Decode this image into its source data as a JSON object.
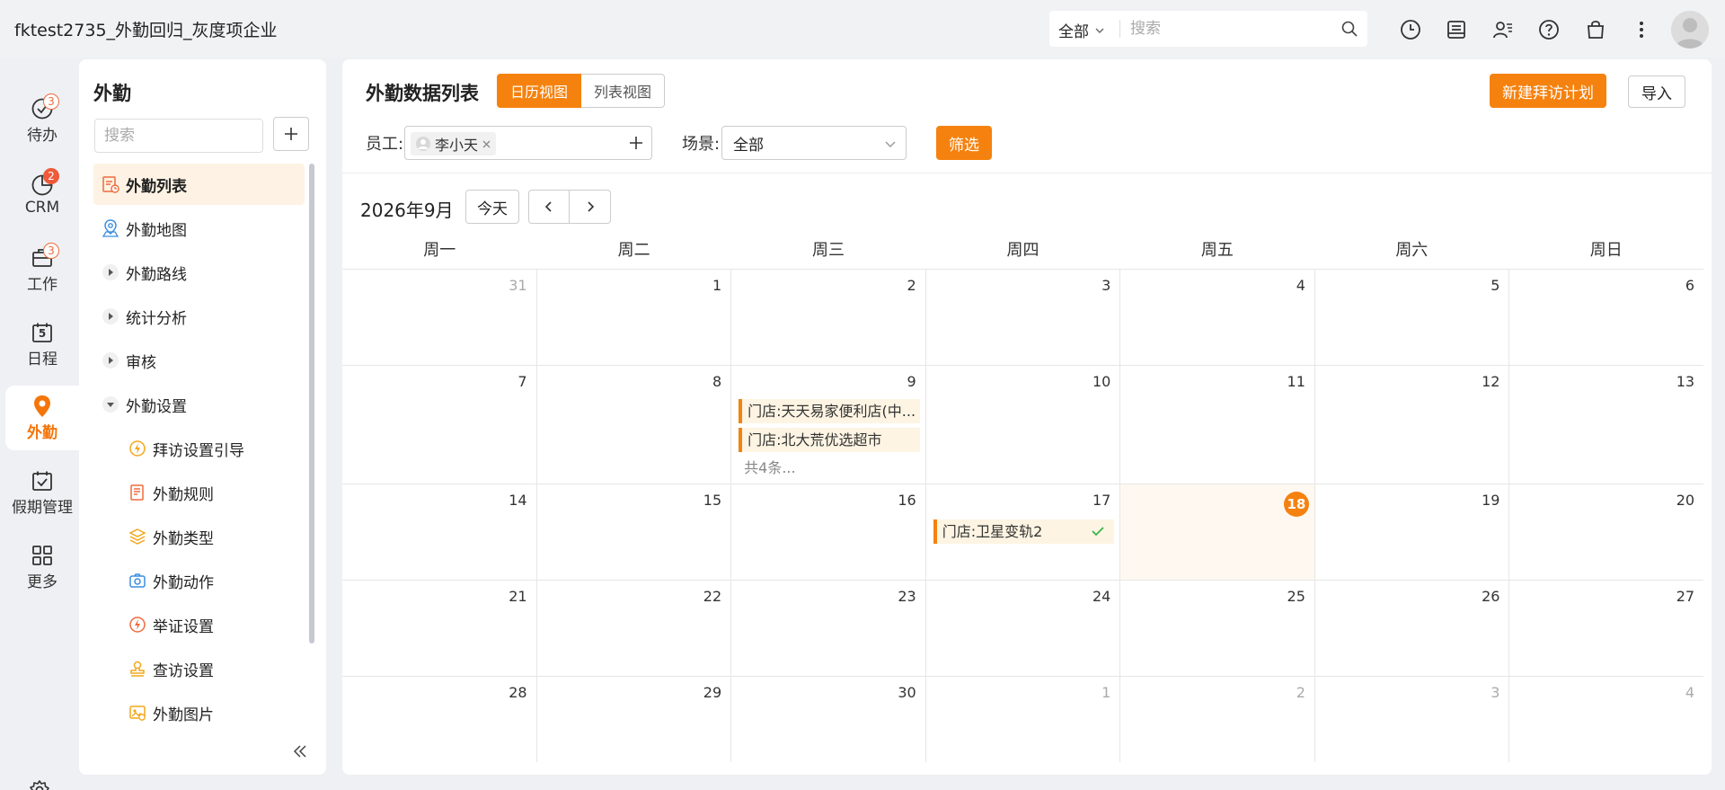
{
  "app": {
    "title": "fktest2735_外勤回归_灰度项企业"
  },
  "search": {
    "scope": "全部",
    "placeholder": "搜索"
  },
  "rail": {
    "items": [
      {
        "label": "待办",
        "badge": "3"
      },
      {
        "label": "CRM",
        "badge": "2"
      },
      {
        "label": "工作",
        "badge": "3"
      },
      {
        "label": "日程",
        "icon_text": "5"
      },
      {
        "label": "外勤"
      },
      {
        "label": "假期管理"
      },
      {
        "label": "更多"
      }
    ]
  },
  "sidebar": {
    "title": "外勤",
    "search_placeholder": "搜索",
    "items": [
      {
        "label": "外勤列表"
      },
      {
        "label": "外勤地图"
      },
      {
        "label": "外勤路线"
      },
      {
        "label": "统计分析"
      },
      {
        "label": "审核"
      },
      {
        "label": "外勤设置"
      },
      {
        "label": "拜访设置引导"
      },
      {
        "label": "外勤规则"
      },
      {
        "label": "外勤类型"
      },
      {
        "label": "外勤动作"
      },
      {
        "label": "举证设置"
      },
      {
        "label": "查访设置"
      },
      {
        "label": "外勤图片"
      }
    ]
  },
  "main": {
    "title": "外勤数据列表",
    "view_calendar": "日历视图",
    "view_list": "列表视图",
    "new_plan": "新建拜访计划",
    "import": "导入",
    "employee_label": "员工:",
    "employee_tag": "李小天",
    "scene_label": "场景:",
    "scene_value": "全部",
    "filter_button": "筛选"
  },
  "calendar": {
    "month_label": "2026年9月",
    "today_button": "今天",
    "weekdays": [
      "周一",
      "周二",
      "周三",
      "周四",
      "周五",
      "周六",
      "周日"
    ],
    "weeks": [
      [
        "31",
        "1",
        "2",
        "3",
        "4",
        "5",
        "6"
      ],
      [
        "7",
        "8",
        "9",
        "10",
        "11",
        "12",
        "13"
      ],
      [
        "14",
        "15",
        "16",
        "17",
        "18",
        "19",
        "20"
      ],
      [
        "21",
        "22",
        "23",
        "24",
        "25",
        "26",
        "27"
      ],
      [
        "28",
        "29",
        "30",
        "1",
        "2",
        "3",
        "4"
      ]
    ],
    "events": {
      "sep9": [
        "门店:天天易家便利店(中...",
        "门店:北大荒优选超市"
      ],
      "sep9_more": "共4条...",
      "sep17": "门店:卫星变轨2"
    }
  },
  "colors": {
    "accent": "#f5820f",
    "badge": "#ee5a3a",
    "success": "#3bb54a"
  }
}
